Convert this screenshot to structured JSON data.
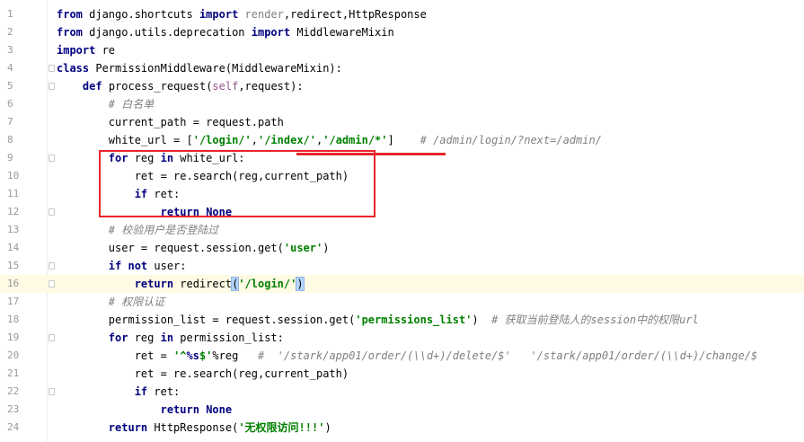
{
  "theme": {
    "keyword": "#000080",
    "string": "#008000",
    "comment": "#808080",
    "self": "#94558D",
    "unused": "#808080",
    "text": "#000000",
    "current_line": "#FFFAE3",
    "bracket_match": "#B3D4FF",
    "annotation": "#E8262A"
  },
  "editor": {
    "lines": [
      {
        "number": "1",
        "tokens": [
          {
            "type": "kw",
            "text": "from"
          },
          {
            "type": "p",
            "text": " django.shortcuts "
          },
          {
            "type": "kw",
            "text": "import"
          },
          {
            "type": "p",
            "text": " "
          },
          {
            "type": "unused",
            "text": "render"
          },
          {
            "type": "p",
            "text": ",redirect,HttpResponse"
          }
        ]
      },
      {
        "number": "2",
        "tokens": [
          {
            "type": "kw",
            "text": "from"
          },
          {
            "type": "p",
            "text": " django.utils.deprecation "
          },
          {
            "type": "kw",
            "text": "import"
          },
          {
            "type": "p",
            "text": " MiddlewareMixin"
          }
        ]
      },
      {
        "number": "3",
        "tokens": [
          {
            "type": "kw",
            "text": "import"
          },
          {
            "type": "p",
            "text": " re"
          }
        ]
      },
      {
        "number": "4",
        "fold": true,
        "tokens": [
          {
            "type": "kw",
            "text": "class"
          },
          {
            "type": "p",
            "text": " PermissionMiddleware(MiddlewareMixin):"
          }
        ]
      },
      {
        "number": "5",
        "fold": true,
        "tokens": [
          {
            "type": "p",
            "text": "    "
          },
          {
            "type": "kw",
            "text": "def"
          },
          {
            "type": "p",
            "text": " process_request("
          },
          {
            "type": "self",
            "text": "self"
          },
          {
            "type": "p",
            "text": ",request):"
          }
        ]
      },
      {
        "number": "6",
        "tokens": [
          {
            "type": "p",
            "text": "        "
          },
          {
            "type": "cm",
            "text": "# 白名单"
          }
        ]
      },
      {
        "number": "7",
        "tokens": [
          {
            "type": "p",
            "text": "        current_path = request.path"
          }
        ]
      },
      {
        "number": "8",
        "tokens": [
          {
            "type": "p",
            "text": "        white_url = ["
          },
          {
            "type": "str",
            "text": "'/login/'"
          },
          {
            "type": "p",
            "text": ","
          },
          {
            "type": "str",
            "text": "'/index/'"
          },
          {
            "type": "p",
            "text": ","
          },
          {
            "type": "str",
            "text": "'/admin/*'"
          },
          {
            "type": "p",
            "text": "]    "
          },
          {
            "type": "cm",
            "text": "# /admin/login/?next=/admin/"
          }
        ]
      },
      {
        "number": "9",
        "fold": true,
        "tokens": [
          {
            "type": "p",
            "text": "        "
          },
          {
            "type": "kw",
            "text": "for"
          },
          {
            "type": "p",
            "text": " reg "
          },
          {
            "type": "kw",
            "text": "in"
          },
          {
            "type": "p",
            "text": " white_url:"
          }
        ]
      },
      {
        "number": "10",
        "tokens": [
          {
            "type": "p",
            "text": "            ret = re.search(reg,current_path)"
          }
        ]
      },
      {
        "number": "11",
        "tokens": [
          {
            "type": "p",
            "text": "            "
          },
          {
            "type": "kw",
            "text": "if"
          },
          {
            "type": "p",
            "text": " ret:"
          }
        ]
      },
      {
        "number": "12",
        "fold": true,
        "tokens": [
          {
            "type": "p",
            "text": "                "
          },
          {
            "type": "kw",
            "text": "return"
          },
          {
            "type": "p",
            "text": " "
          },
          {
            "type": "kw",
            "text": "None"
          }
        ]
      },
      {
        "number": "13",
        "tokens": [
          {
            "type": "p",
            "text": "        "
          },
          {
            "type": "cm",
            "text": "# 校验用户是否登陆过"
          }
        ]
      },
      {
        "number": "14",
        "tokens": [
          {
            "type": "p",
            "text": "        user = request.session.get("
          },
          {
            "type": "str",
            "text": "'user'"
          },
          {
            "type": "p",
            "text": ")"
          }
        ]
      },
      {
        "number": "15",
        "fold": true,
        "tokens": [
          {
            "type": "p",
            "text": "        "
          },
          {
            "type": "kw",
            "text": "if"
          },
          {
            "type": "p",
            "text": " "
          },
          {
            "type": "kw",
            "text": "not"
          },
          {
            "type": "p",
            "text": " user:"
          }
        ]
      },
      {
        "number": "16",
        "fold": true,
        "current": true,
        "caret": true,
        "tokens": [
          {
            "type": "p",
            "text": "            "
          },
          {
            "type": "kw",
            "text": "return"
          },
          {
            "type": "p",
            "text": " redirect"
          },
          {
            "type": "match",
            "text": "("
          },
          {
            "type": "str",
            "text": "'/login/'"
          },
          {
            "type": "match",
            "text": ")"
          }
        ]
      },
      {
        "number": "17",
        "tokens": [
          {
            "type": "p",
            "text": "        "
          },
          {
            "type": "cm",
            "text": "# 权限认证"
          }
        ]
      },
      {
        "number": "18",
        "tokens": [
          {
            "type": "p",
            "text": "        permission_list = request.session.get("
          },
          {
            "type": "str",
            "text": "'permissions_list'"
          },
          {
            "type": "p",
            "text": ")  "
          },
          {
            "type": "cm",
            "text": "# 获取当前登陆人的session中的权限url"
          }
        ]
      },
      {
        "number": "19",
        "fold": true,
        "tokens": [
          {
            "type": "p",
            "text": "        "
          },
          {
            "type": "kw",
            "text": "for"
          },
          {
            "type": "p",
            "text": " reg "
          },
          {
            "type": "kw",
            "text": "in"
          },
          {
            "type": "p",
            "text": " permission_list:"
          }
        ]
      },
      {
        "number": "20",
        "tokens": [
          {
            "type": "p",
            "text": "            ret = "
          },
          {
            "type": "str",
            "text": "'^"
          },
          {
            "type": "fmt",
            "text": "%s"
          },
          {
            "type": "str",
            "text": "$'"
          },
          {
            "type": "p",
            "text": "%reg   "
          },
          {
            "type": "cm",
            "text": "#  '/stark/app01/order/(\\\\d+)/delete/$'   '/stark/app01/order/(\\\\d+)/change/$"
          }
        ]
      },
      {
        "number": "21",
        "tokens": [
          {
            "type": "p",
            "text": "            ret = re.search(reg,current_path)"
          }
        ]
      },
      {
        "number": "22",
        "fold": true,
        "tokens": [
          {
            "type": "p",
            "text": "            "
          },
          {
            "type": "kw",
            "text": "if"
          },
          {
            "type": "p",
            "text": " ret:"
          }
        ]
      },
      {
        "number": "23",
        "tokens": [
          {
            "type": "p",
            "text": "                "
          },
          {
            "type": "kw",
            "text": "return"
          },
          {
            "type": "p",
            "text": " "
          },
          {
            "type": "kw",
            "text": "None"
          }
        ]
      },
      {
        "number": "24",
        "tokens": [
          {
            "type": "p",
            "text": "        "
          },
          {
            "type": "kw",
            "text": "return"
          },
          {
            "type": "p",
            "text": " HttpResponse("
          },
          {
            "type": "str",
            "text": "'无权限访问!!!'"
          },
          {
            "type": "p",
            "text": ")"
          }
        ]
      }
    ]
  }
}
